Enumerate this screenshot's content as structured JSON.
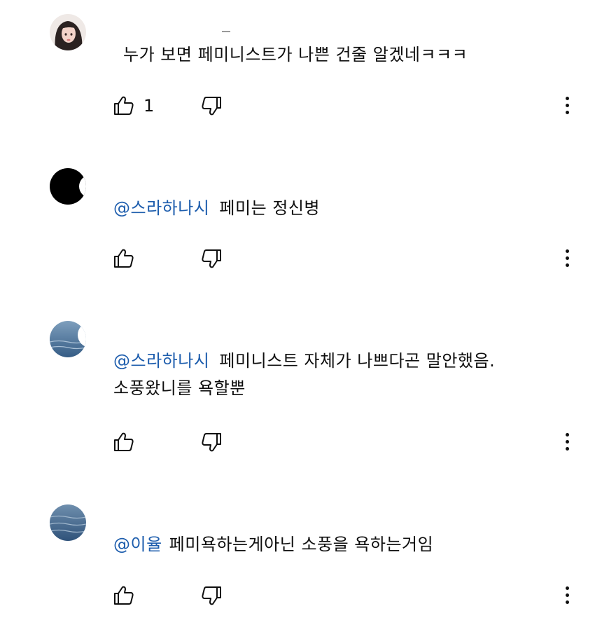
{
  "comments": [
    {
      "avatar": "avatar-photo-girl",
      "mention": "",
      "text": "누가 보면 페미니스트가 나쁜 건줄 알겠네ㅋㅋㅋ",
      "like_icon": "thumb-up-icon",
      "likes": "1",
      "dislike_icon": "thumb-down-icon",
      "more_icon": "more-vert-icon"
    },
    {
      "avatar": "avatar-black-moon",
      "mention": "@스라하나시",
      "text": "페미는 정신병",
      "like_icon": "thumb-up-icon",
      "likes": "",
      "dislike_icon": "thumb-down-icon",
      "more_icon": "more-vert-icon"
    },
    {
      "avatar": "avatar-sea-moon",
      "mention": "@스라하나시",
      "text": "페미니스트 자체가 나쁘다곤 말안했음. 소풍왔니를 욕할뿐",
      "like_icon": "thumb-up-icon",
      "likes": "",
      "dislike_icon": "thumb-down-icon",
      "more_icon": "more-vert-icon"
    },
    {
      "avatar": "avatar-sea",
      "mention": "@이율",
      "text": "페미욕하는게아닌 소풍을 욕하는거임",
      "like_icon": "thumb-up-icon",
      "likes": "",
      "dislike_icon": "thumb-down-icon",
      "more_icon": "more-vert-icon"
    }
  ],
  "colors": {
    "mention": "#1d5dad",
    "text": "#0f0f0f",
    "background": "#ffffff"
  }
}
